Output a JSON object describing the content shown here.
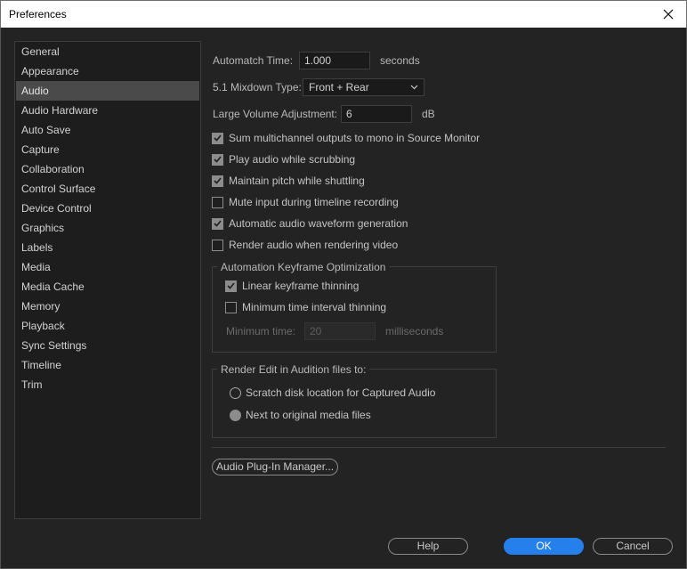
{
  "window": {
    "title": "Preferences"
  },
  "sidebar": {
    "items": [
      {
        "label": "General"
      },
      {
        "label": "Appearance"
      },
      {
        "label": "Audio",
        "selected": true
      },
      {
        "label": "Audio Hardware"
      },
      {
        "label": "Auto Save"
      },
      {
        "label": "Capture"
      },
      {
        "label": "Collaboration"
      },
      {
        "label": "Control Surface"
      },
      {
        "label": "Device Control"
      },
      {
        "label": "Graphics"
      },
      {
        "label": "Labels"
      },
      {
        "label": "Media"
      },
      {
        "label": "Media Cache"
      },
      {
        "label": "Memory"
      },
      {
        "label": "Playback"
      },
      {
        "label": "Sync Settings"
      },
      {
        "label": "Timeline"
      },
      {
        "label": "Trim"
      }
    ]
  },
  "audio": {
    "automatch_label": "Automatch Time:",
    "automatch_value": "1.000",
    "automatch_unit": "seconds",
    "mixdown_label": "5.1 Mixdown Type:",
    "mixdown_value": "Front + Rear",
    "volume_label": "Large Volume Adjustment:",
    "volume_value": "6",
    "volume_unit": "dB",
    "checkboxes": [
      {
        "label": "Sum multichannel outputs to mono in Source Monitor",
        "checked": true
      },
      {
        "label": "Play audio while scrubbing",
        "checked": true
      },
      {
        "label": "Maintain pitch while shuttling",
        "checked": true
      },
      {
        "label": "Mute input during timeline recording",
        "checked": false
      },
      {
        "label": "Automatic audio waveform generation",
        "checked": true
      },
      {
        "label": "Render audio when rendering video",
        "checked": false
      }
    ],
    "keyframe_group": {
      "title": "Automation Keyframe Optimization",
      "linear_label": "Linear keyframe thinning",
      "linear_checked": true,
      "min_interval_label": "Minimum time interval thinning",
      "min_interval_checked": false,
      "min_time_label": "Minimum time:",
      "min_time_value": "20",
      "min_time_unit": "milliseconds"
    },
    "render_group": {
      "title": "Render Edit in Audition files to:",
      "options": [
        {
          "label": "Scratch disk location for Captured Audio",
          "selected": false
        },
        {
          "label": "Next to original media files",
          "selected": true
        }
      ]
    },
    "plugin_button": "Audio Plug-In Manager..."
  },
  "footer": {
    "help": "Help",
    "ok": "OK",
    "cancel": "Cancel"
  },
  "colors": {
    "accent": "#2680eb",
    "background": "#232323",
    "selected_item": "#4a4a4a"
  }
}
